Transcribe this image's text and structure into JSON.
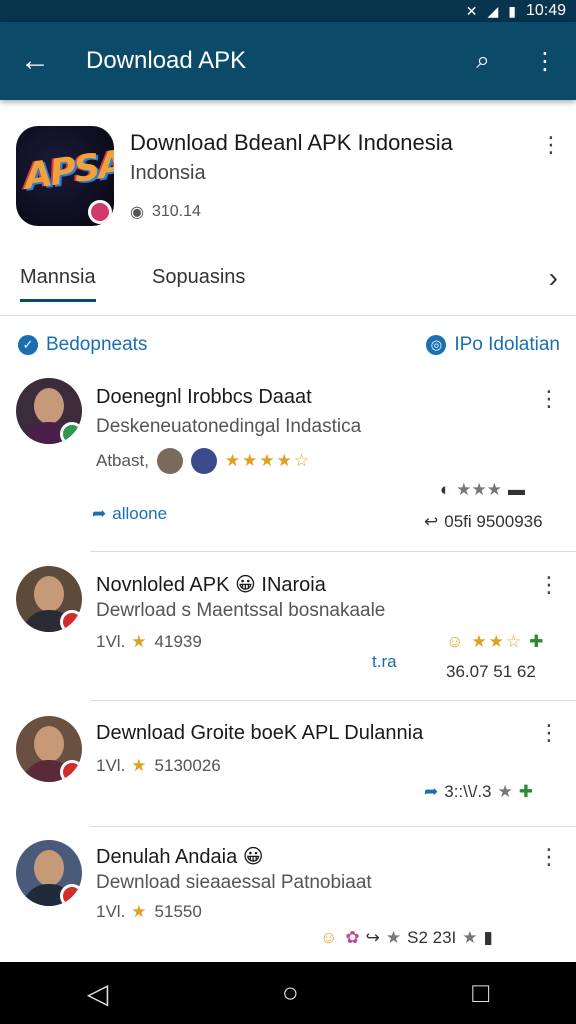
{
  "status_bar": {
    "time": "10:49"
  },
  "app_bar": {
    "title": "Download APK"
  },
  "header": {
    "app_name": "Download Bdeanl APK Indonesia",
    "subtitle": "Indonsia",
    "meta": "310.14",
    "icon_text": "APSA"
  },
  "tabs": {
    "active": "Mannsia",
    "second": "Sopuasins"
  },
  "section": {
    "left": "Bedopneats",
    "right": "IPo Idolatian"
  },
  "reviews": [
    {
      "title": "Doenegnl Irobbcs Daaat",
      "sub": "Deskeneuatonedingal Indastica",
      "meta_label": "Atbast,",
      "stars": "★★★★☆",
      "action": "alloone",
      "right_icons": "★★★",
      "right_value": "05fi 9500936"
    },
    {
      "title": "Novnloled APK 😀 INaroia",
      "sub": "Dewrload s Maentssal bosnakaale",
      "meta_label": "1Vl.",
      "meta_value": "41939",
      "left_action": "t.ra",
      "right_value": "36.07   51 62"
    },
    {
      "title": "Dewnload Groite boeK APL Dulannia",
      "sub": "",
      "meta_label": "1Vl.",
      "meta_value": "5130026",
      "right_value": "3::\\\\/.3"
    },
    {
      "title": "Denulah Andaia 😀",
      "sub": "Dewnload sieaaessal Patnobiaat",
      "meta_label": "1Vl.",
      "meta_value": "51550",
      "right_value": "S2 23I"
    }
  ],
  "colors": {
    "app_bar": "#0c4a69",
    "accent": "#1a6fb0",
    "star": "#e0a020"
  },
  "icons": {
    "back": "arrow-left-icon",
    "search": "search-icon",
    "overflow": "more-vert-icon"
  }
}
